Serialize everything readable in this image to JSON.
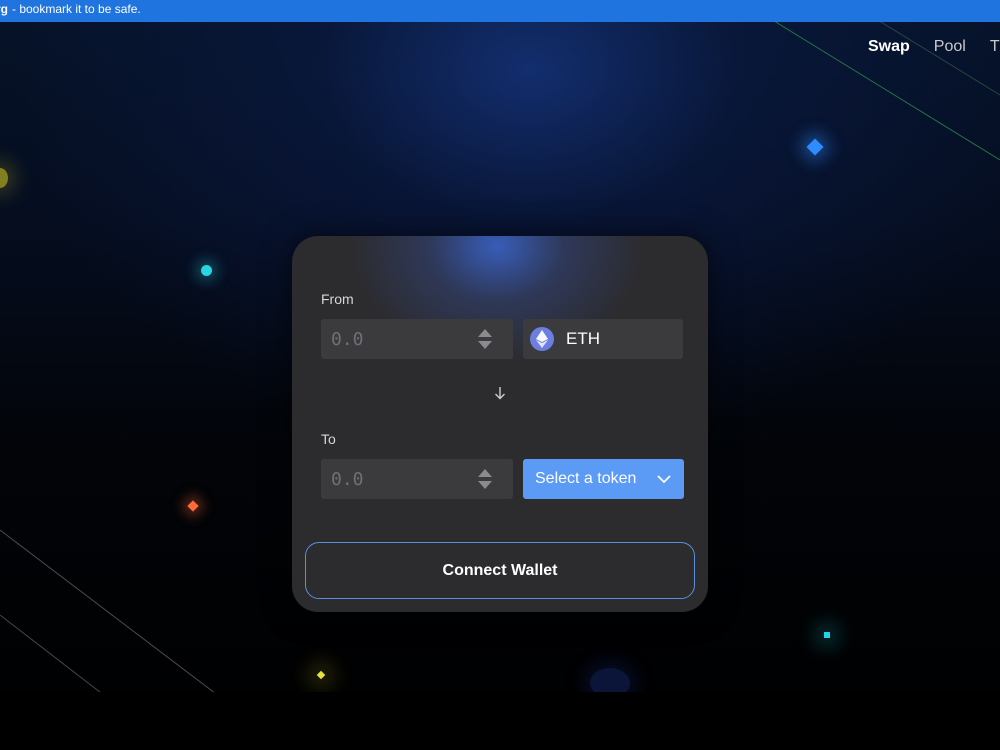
{
  "banner": {
    "domain_fragment": "rg",
    "text": "- bookmark it to be safe."
  },
  "nav": {
    "items": [
      {
        "label": "Swap",
        "active": true
      },
      {
        "label": "Pool",
        "active": false
      },
      {
        "label": "T",
        "active": false
      }
    ]
  },
  "swap": {
    "from_label": "From",
    "from_placeholder": "0.0",
    "from_token": "ETH",
    "to_label": "To",
    "to_placeholder": "0.0",
    "select_token_label": "Select a token",
    "connect_label": "Connect Wallet"
  },
  "colors": {
    "banner": "#1f74e0",
    "card": "#2c2b2d",
    "input": "#3b3a3d",
    "accent": "#5b9af5",
    "connect_border": "#5b8fe0"
  },
  "icons": {
    "token": "eth-icon",
    "stepper": "up-down-stepper-icon",
    "swap_direction": "arrow-down-icon",
    "dropdown": "chevron-down-icon"
  }
}
